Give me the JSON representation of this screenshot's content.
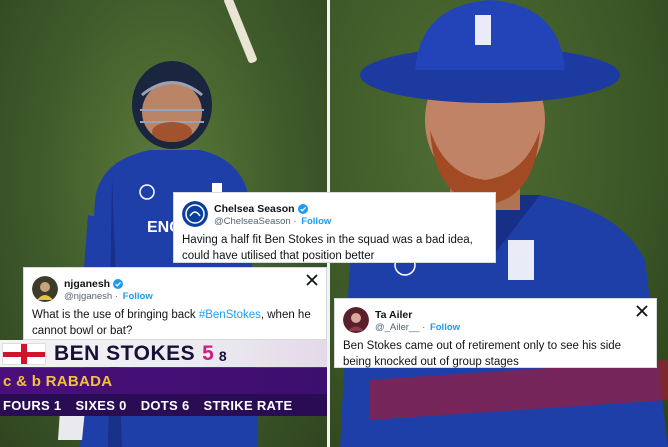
{
  "tweets": [
    {
      "name": "Chelsea Season",
      "handle": "@ChelseaSeason",
      "follow": "Follow",
      "text": "Having a half fit Ben Stokes in the squad was a bad idea, could have utilised that position better"
    },
    {
      "name": "njganesh",
      "handle": "@njganesh",
      "follow": "Follow",
      "text_before": "What is the use of bringing back ",
      "hashtag": "#BenStokes",
      "text_after": ", when he cannot bowl or bat?"
    },
    {
      "name": "Ta Ailer",
      "handle": "@_Ailer__",
      "follow": "Follow",
      "text": "Ben Stokes came out of retirement only to see his side being knocked out of group stages"
    }
  ],
  "scorecard": {
    "player": "BEN STOKES",
    "runs": "5",
    "balls": "8",
    "dismissal": "c & b RABADA",
    "fours_label": "FOURS",
    "fours": "1",
    "sixes_label": "SIXES",
    "sixes": "0",
    "dots_label": "DOTS",
    "dots": "6",
    "strike_rate_label": "STRIKE RATE"
  },
  "photo_text": {
    "jersey_left": "ENG"
  },
  "colors": {
    "jersey": "#1f3fa8",
    "verified": "#1d9bf0",
    "scorecard_purple": "#3c0f6e",
    "scorecard_yellow": "#f3c23a",
    "runs_pink": "#d21d7c"
  }
}
